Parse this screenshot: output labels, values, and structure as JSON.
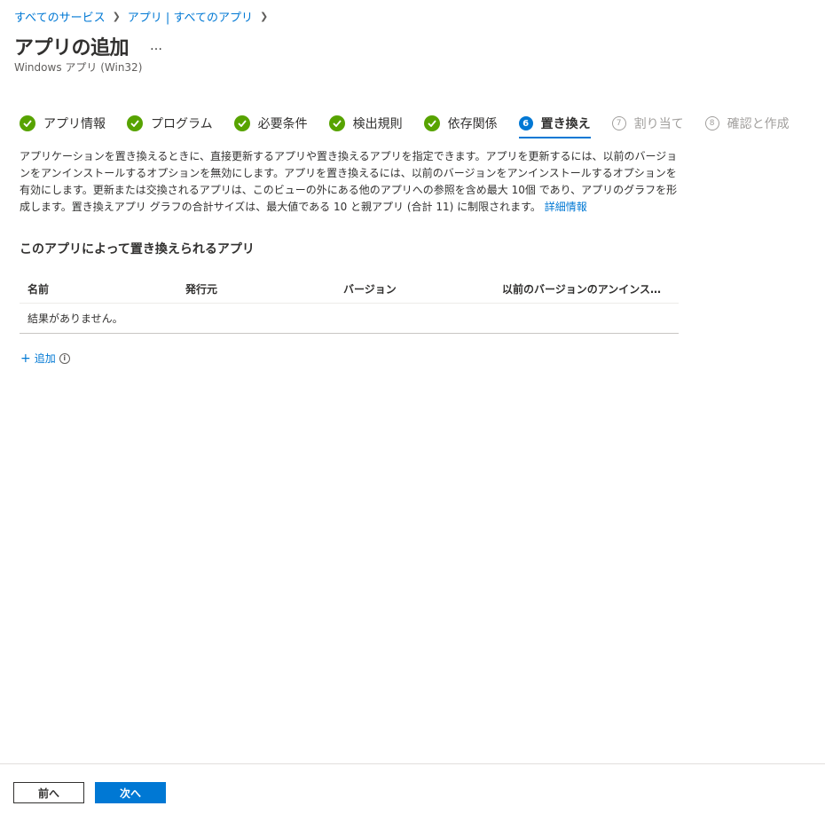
{
  "breadcrumb": [
    "すべてのサービス",
    "アプリ | すべてのアプリ"
  ],
  "header": {
    "title": "アプリの追加",
    "more": "…",
    "subtitle": "Windows アプリ (Win32)"
  },
  "steps": [
    {
      "label": "アプリ情報",
      "state": "done"
    },
    {
      "label": "プログラム",
      "state": "done"
    },
    {
      "label": "必要条件",
      "state": "done"
    },
    {
      "label": "検出規則",
      "state": "done"
    },
    {
      "label": "依存関係",
      "state": "done"
    },
    {
      "label": "置き換え",
      "state": "active",
      "number": "6"
    },
    {
      "label": "割り当て",
      "state": "disabled",
      "number": "7"
    },
    {
      "label": "確認と作成",
      "state": "disabled",
      "number": "8"
    }
  ],
  "description": {
    "text": "アプリケーションを置き換えるときに、直接更新するアプリや置き換えるアプリを指定できます。アプリを更新するには、以前のバージョンをアンインストールするオプションを無効にします。アプリを置き換えるには、以前のバージョンをアンインストールするオプションを有効にします。更新または交換されるアプリは、このビューの外にある他のアプリへの参照を含め最大 10個 であり、アプリのグラフを形成します。置き換えアプリ グラフの合計サイズは、最大値である 10 と親アプリ (合計 11) に制限されます。",
    "link": "詳細情報"
  },
  "section": {
    "title": "このアプリによって置き換えられるアプリ"
  },
  "table": {
    "columns": [
      "名前",
      "発行元",
      "バージョン",
      "以前のバージョンのアンインス…"
    ],
    "empty": "結果がありません。"
  },
  "add": {
    "plus": "+",
    "label": "追加",
    "info": "i"
  },
  "footer": {
    "prev": "前へ",
    "next": "次へ"
  },
  "colors": {
    "link": "#0078d4",
    "check": "#57a300",
    "primary": "#0078d4"
  }
}
